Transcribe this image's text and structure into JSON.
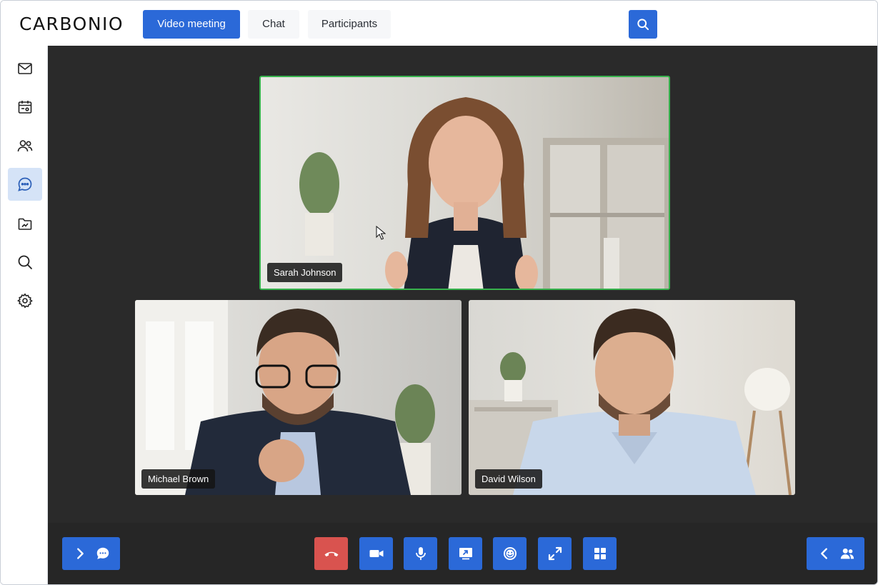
{
  "app": {
    "logo": "CARBONIO"
  },
  "header": {
    "tabs": [
      {
        "label": "Video meeting",
        "active": true
      },
      {
        "label": "Chat",
        "active": false
      },
      {
        "label": "Participants",
        "active": false
      }
    ],
    "search_icon": "search-icon"
  },
  "sidebar": {
    "items": [
      {
        "icon": "mail-icon",
        "active": false
      },
      {
        "icon": "calendar-icon",
        "active": false
      },
      {
        "icon": "contacts-icon",
        "active": false
      },
      {
        "icon": "chat-icon",
        "active": true
      },
      {
        "icon": "files-icon",
        "active": false
      },
      {
        "icon": "search-icon",
        "active": false
      },
      {
        "icon": "gear-icon",
        "active": false
      }
    ]
  },
  "participants": [
    {
      "name": "Sarah Johnson",
      "speaking": true
    },
    {
      "name": "Michael Brown",
      "speaking": false
    },
    {
      "name": "David Wilson",
      "speaking": false
    }
  ],
  "controls": {
    "left": "expand-chat",
    "center": [
      "hangup",
      "camera",
      "microphone",
      "screen-share",
      "emoji",
      "fullscreen",
      "grid-view"
    ],
    "right": "expand-participants"
  },
  "colors": {
    "accent": "#2b69d8",
    "hangup": "#d9534f",
    "speaking": "#37b24d",
    "stage": "#2a2a2a"
  }
}
